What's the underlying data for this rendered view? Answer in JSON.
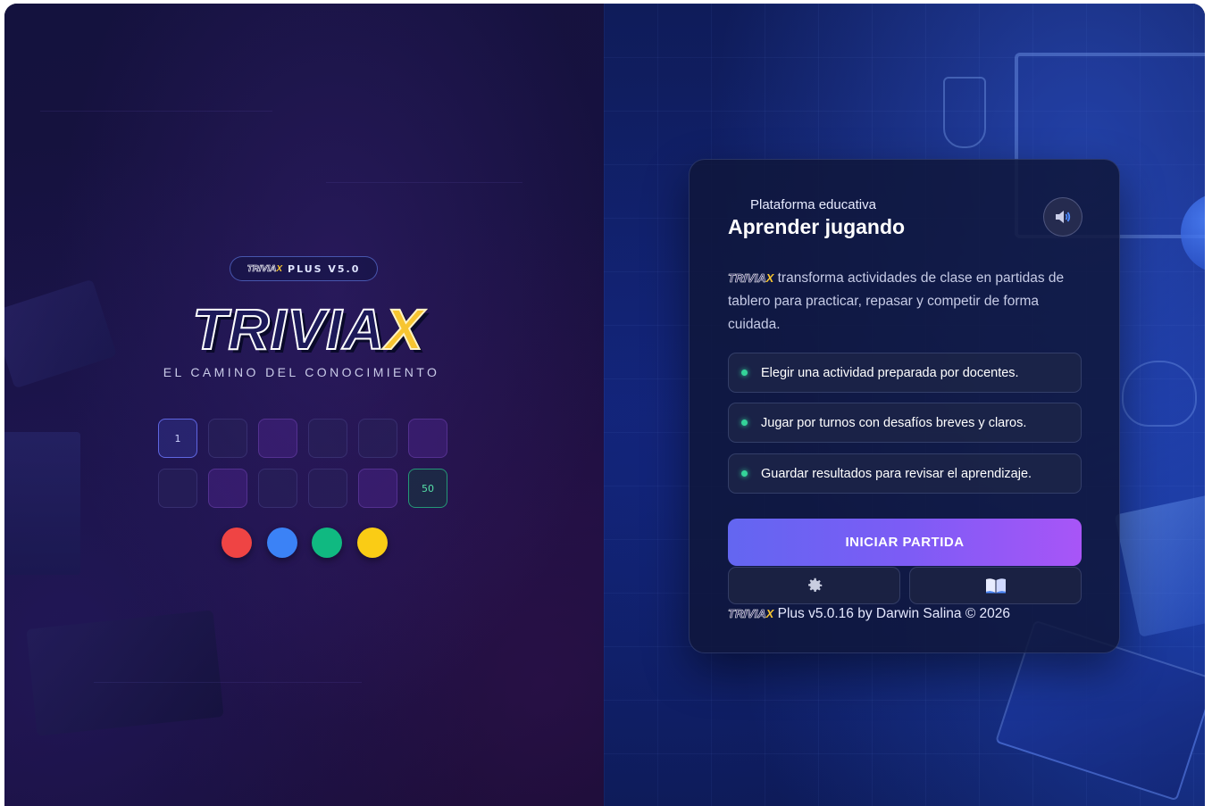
{
  "hero": {
    "version_badge_logo_main": "TRIVIA",
    "version_badge_logo_x": "X",
    "version_badge_text": "PLUS V5.0",
    "logo_main": "TRIVIA",
    "logo_x": "X",
    "tagline": "EL CAMINO DEL CONOCIMIENTO",
    "board": {
      "start_label": "1",
      "finish_label": "50"
    },
    "tokens": [
      "#ef4444",
      "#3b82f6",
      "#10b981",
      "#facc15"
    ]
  },
  "card": {
    "eyebrow": "Plataforma educativa",
    "title": "Aprender jugando",
    "sound_icon": "speaker-icon",
    "description_logo_main": "TRIVIA",
    "description_logo_x": "X",
    "description": "transforma actividades de clase en partidas de tablero para practicar, repasar y competir de forma cuidada.",
    "features": [
      "Elegir una actividad preparada por docentes.",
      "Jugar por turnos con desafíos breves y claros.",
      "Guardar resultados para revisar el aprendizaje."
    ],
    "cta_label": "INICIAR PARTIDA",
    "settings_icon": "gear-icon",
    "guide_icon": "book-icon",
    "footer_logo_main": "TRIVIA",
    "footer_logo_x": "X",
    "footer_text": "Plus v5.0.16 by Darwin Salina © 2026"
  },
  "colors": {
    "accent_start": "#6366f1",
    "accent_end": "#a855f7",
    "feature_dot": "#34d399",
    "logo_x": "#f7c531"
  }
}
